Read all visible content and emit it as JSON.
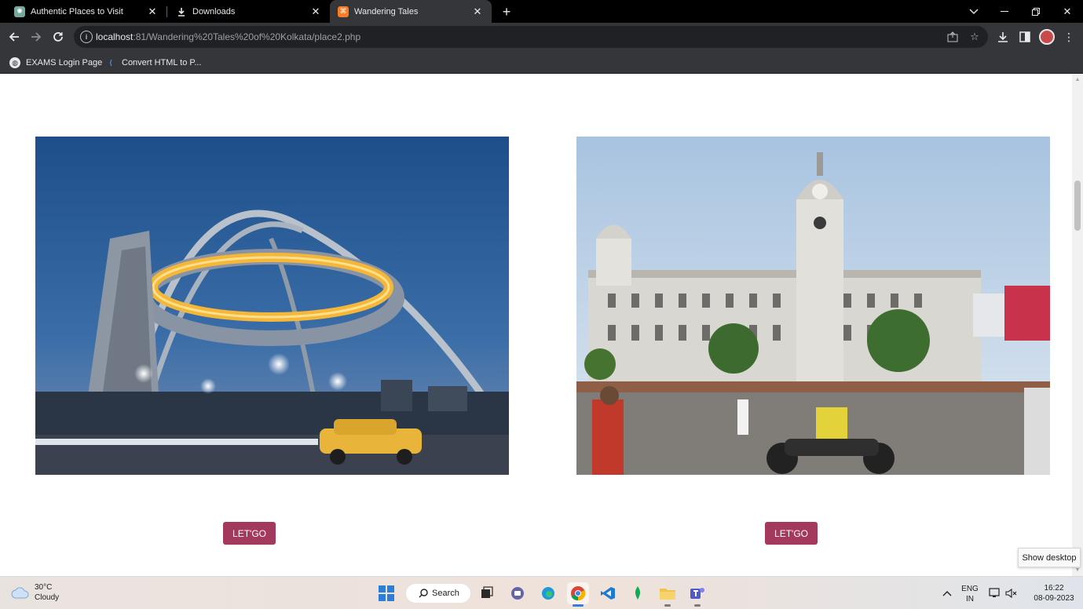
{
  "browser": {
    "tabs": [
      {
        "label": "Authentic Places to Visit",
        "icon": "chatgpt-icon",
        "active": false
      },
      {
        "label": "Downloads",
        "icon": "download-icon",
        "active": false
      },
      {
        "label": "Wandering Tales",
        "icon": "xampp-icon",
        "active": true
      }
    ],
    "url_host": "localhost",
    "url_path": ":81/Wandering%20Tales%20of%20Kolkata/place2.php",
    "bookmarks": [
      {
        "label": "EXAMS Login Page",
        "icon": "globe-icon"
      },
      {
        "label": "Convert HTML to P...",
        "icon": "convert-icon"
      }
    ]
  },
  "page": {
    "cards": [
      {
        "photo": "Biswa Bangla Gate arch ring at dusk with a yellow taxi",
        "button": "LET'GO"
      },
      {
        "photo": "Metropolitan Building, Esplanade, Kolkata",
        "button": "LET'GO"
      }
    ]
  },
  "tooltip": "Show desktop",
  "taskbar": {
    "weather_temp": "30°C",
    "weather_desc": "Cloudy",
    "search_label": "Search",
    "lang_top": "ENG",
    "lang_bottom": "IN",
    "time": "16:22",
    "date": "08-09-2023"
  },
  "colors": {
    "button_bg": "#a3395d",
    "chrome_dark": "#35363a",
    "tab_strip": "#000000"
  }
}
